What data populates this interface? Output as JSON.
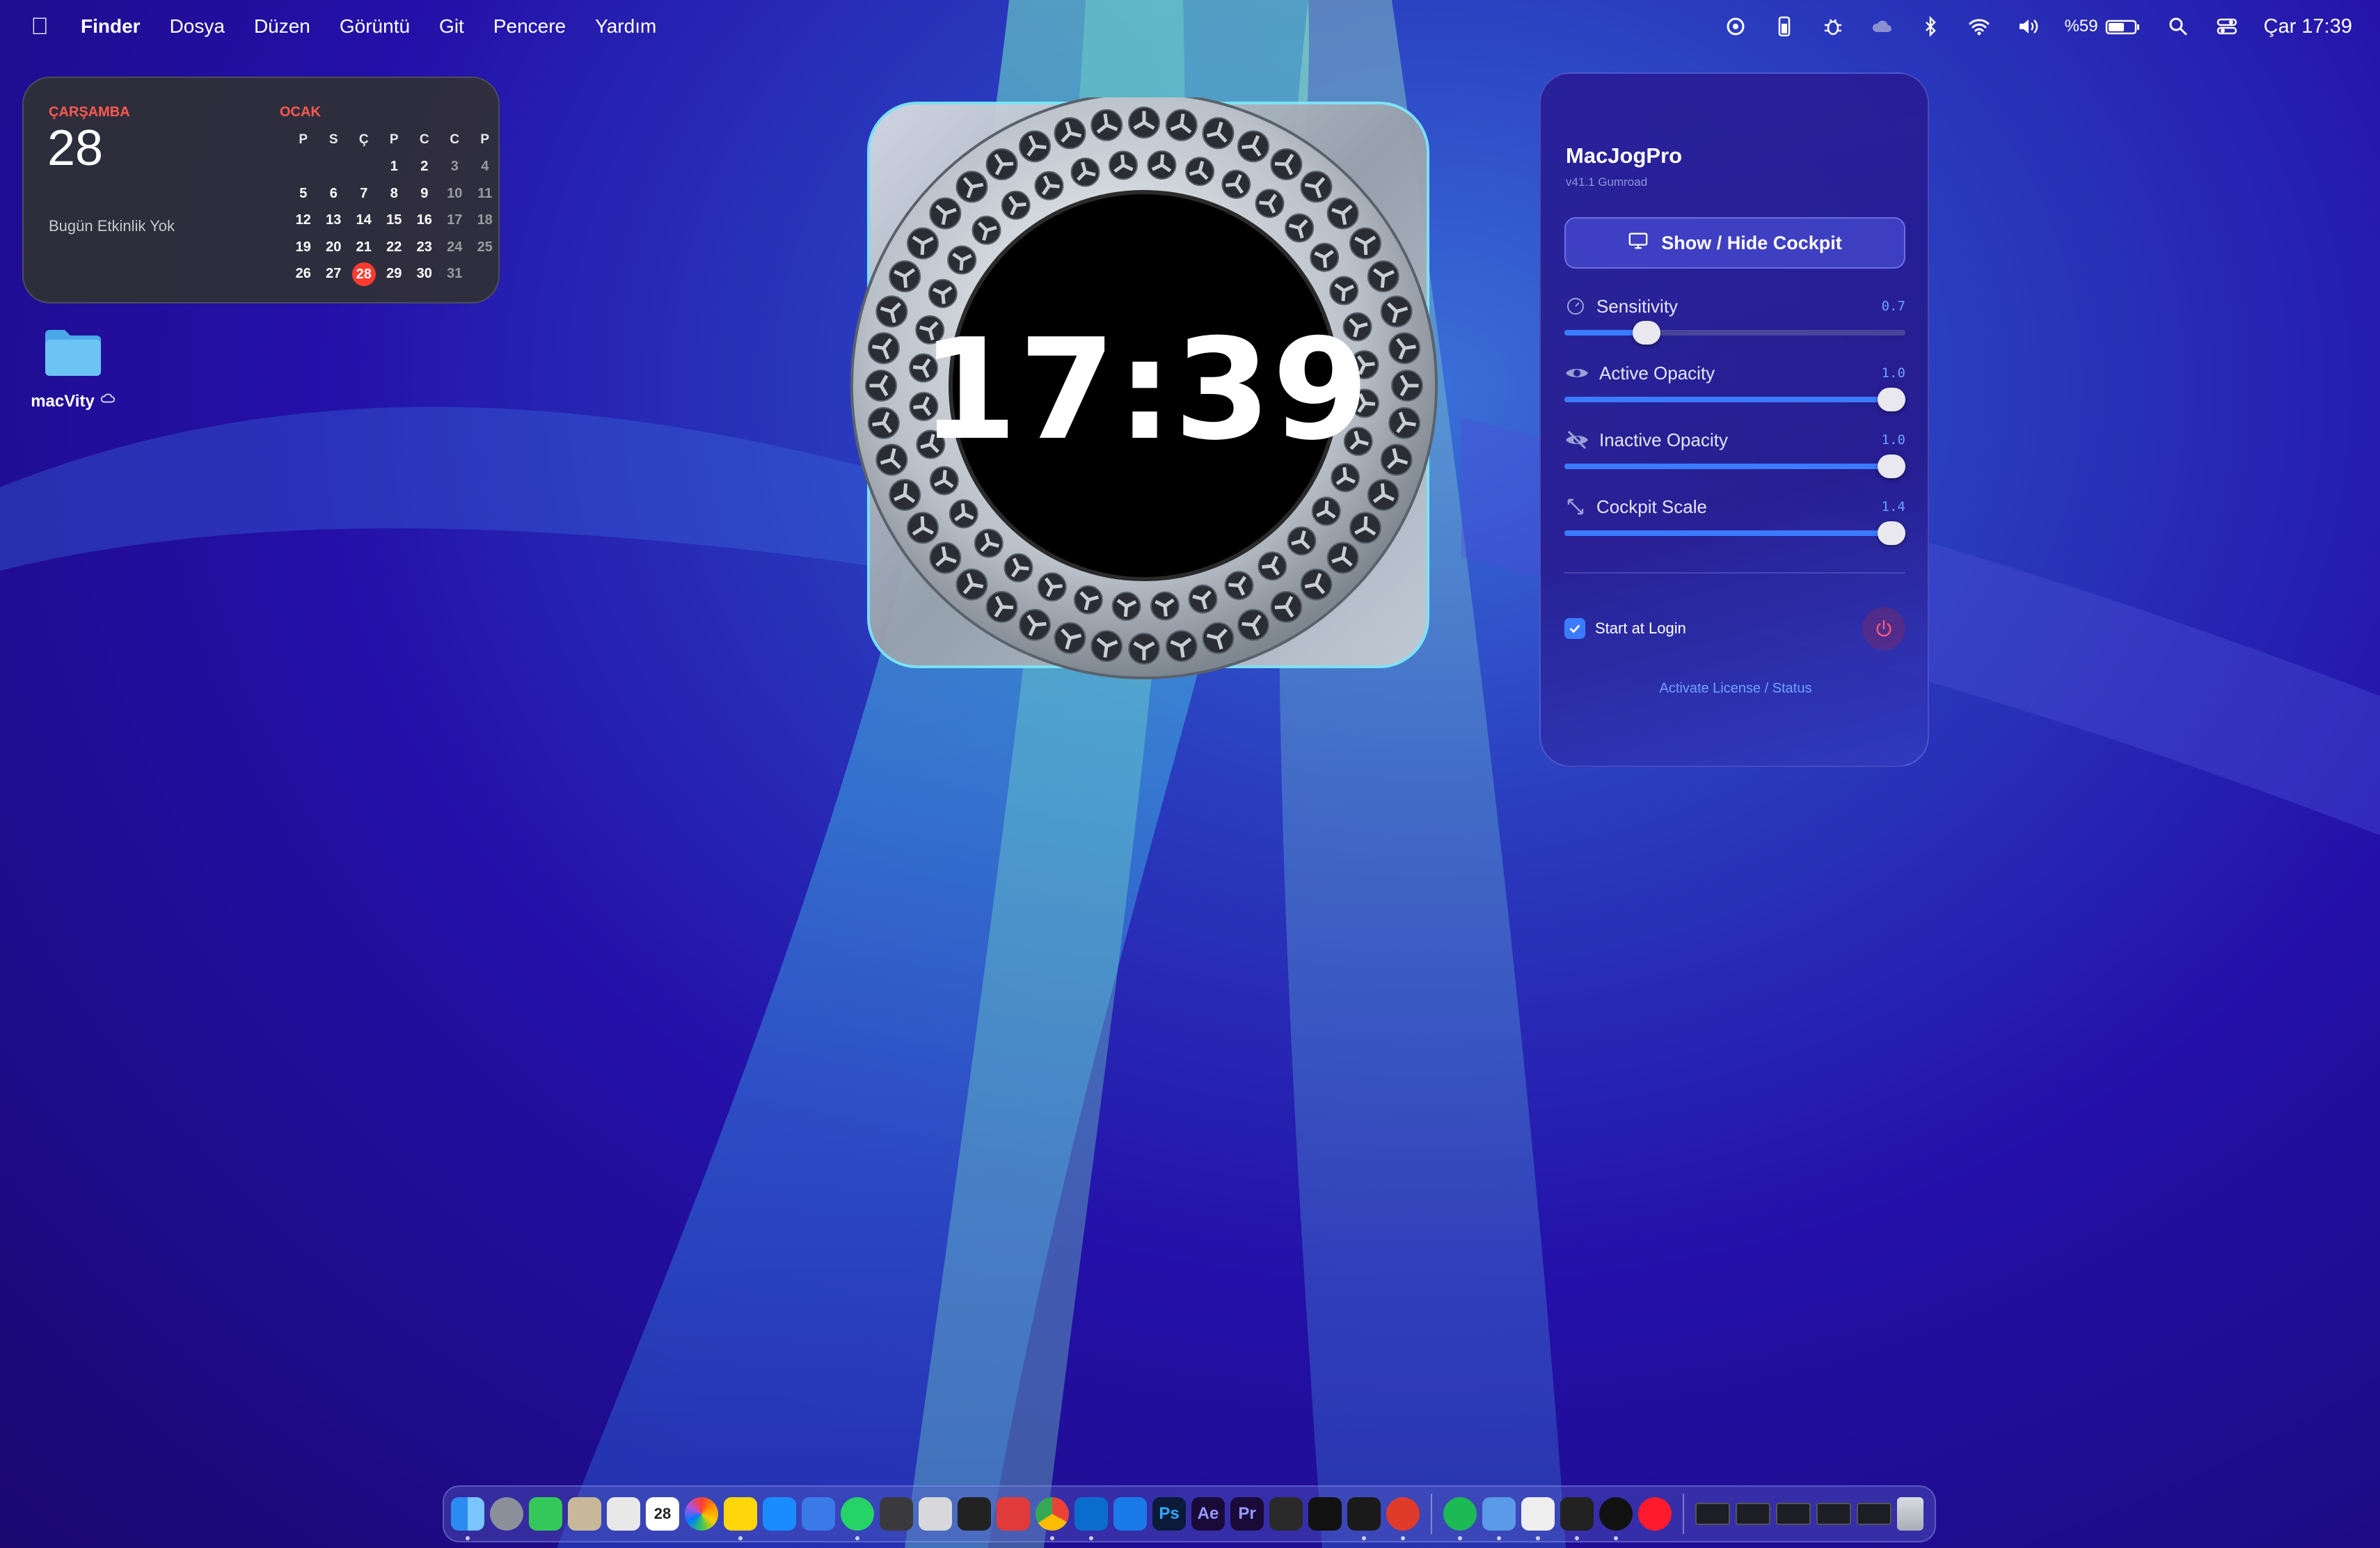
{
  "menubar": {
    "app_name": "Finder",
    "menus": [
      "Dosya",
      "Düzen",
      "Görüntü",
      "Git",
      "Pencere",
      "Yardım"
    ],
    "battery": "%59",
    "clock": "Çar 17:39",
    "status_icons": [
      "focus-icon",
      "phone-battery-icon",
      "bug-icon",
      "cloud-icon",
      "bluetooth-icon",
      "wifi-icon",
      "volume-icon",
      "battery-icon",
      "spotlight-icon",
      "control-center-icon"
    ]
  },
  "calendar_widget": {
    "day_name": "ÇARŞAMBA",
    "day_number": "28",
    "no_events": "Bugün Etkinlik Yok",
    "month": "OCAK",
    "weekday_headers": [
      "P",
      "S",
      "Ç",
      "P",
      "C",
      "C",
      "P"
    ],
    "weeks": [
      [
        "",
        "",
        "",
        "1",
        "2",
        "3",
        "4"
      ],
      [
        "5",
        "6",
        "7",
        "8",
        "9",
        "10",
        "11"
      ],
      [
        "12",
        "13",
        "14",
        "15",
        "16",
        "17",
        "18"
      ],
      [
        "19",
        "20",
        "21",
        "22",
        "23",
        "24",
        "25"
      ],
      [
        "26",
        "27",
        "28",
        "29",
        "30",
        "31",
        ""
      ]
    ],
    "today": "28"
  },
  "desktop": {
    "folder_label": "macVity"
  },
  "jog_widget": {
    "time": "17:39"
  },
  "panel": {
    "title": "MacJogPro",
    "version": "v41.1 Gumroad",
    "cockpit_button": "Show / Hide Cockpit",
    "sliders": [
      {
        "label": "Sensitivity",
        "value_text": "0.7",
        "fraction": 0.24
      },
      {
        "label": "Active Opacity",
        "value_text": "1.0",
        "fraction": 1.0
      },
      {
        "label": "Inactive Opacity",
        "value_text": "1.0",
        "fraction": 1.0
      },
      {
        "label": "Cockpit Scale",
        "value_text": "1.4",
        "fraction": 1.0
      }
    ],
    "start_at_login": "Start at Login",
    "start_at_login_checked": true,
    "license_link": "Activate License / Status",
    "accent_color": "#3b7bff"
  },
  "dock": {
    "calendar_day": "28",
    "ps_label": "Ps",
    "ae_label": "Ae",
    "pr_label": "Pr",
    "apps": [
      "finder",
      "launchpad",
      "facetime",
      "contacts",
      "calculator-grid",
      "calendar",
      "photos",
      "notes",
      "app-store",
      "books",
      "whatsapp",
      "calculator",
      "preview",
      "terminal-like",
      "pdf",
      "chrome",
      "vscode",
      "xcode",
      "photoshop",
      "after-effects",
      "premiere",
      "blender",
      "capcut",
      "activity-monitor",
      "cast",
      "spotify",
      "finder-2",
      "a46",
      "terminal",
      "screen",
      "opera",
      "trash"
    ]
  }
}
